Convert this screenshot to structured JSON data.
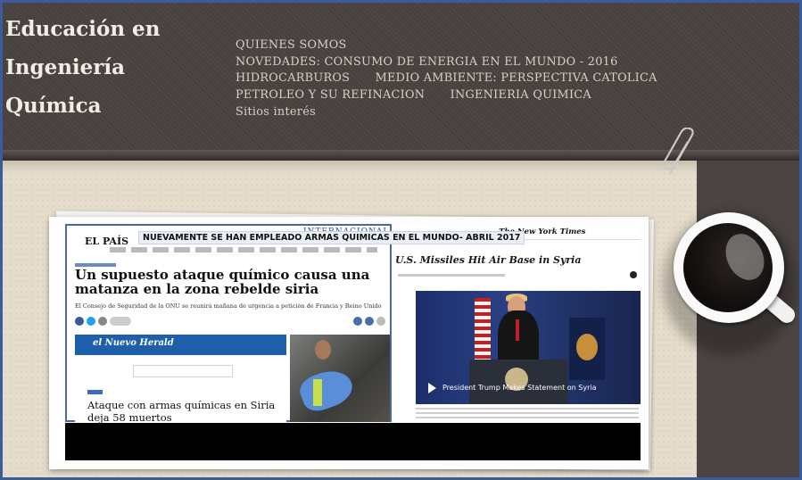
{
  "site": {
    "title_lines": [
      "Educación en",
      "Ingeniería",
      "Química"
    ]
  },
  "nav": {
    "rows": [
      [
        "QUIENES SOMOS"
      ],
      [
        "NOVEDADES: CONSUMO DE ENERGIA EN EL MUNDO - 2016"
      ],
      [
        "HIDROCARBUROS",
        "MEDIO AMBIENTE: PERSPECTIVA CATOLICA"
      ],
      [
        "PETROLEO Y SU REFINACION",
        "INGENIERIA QUIMICA"
      ],
      [
        "Sitios interés"
      ]
    ]
  },
  "featured": {
    "banner": "NUEVAMENTE SE HAN EMPLEADO ARMAS QUIMICAS EN EL MUNDO- ABRIL 2017",
    "elpais": {
      "logo": "EL PAÍS",
      "section": "INTERNACIONAL",
      "headline": "Un supuesto ataque químico causa una matanza en la zona rebelde siria",
      "subhead": "El Consejo de Seguridad de la ONU se reunirá mañana de urgencia a petición de Francia y Reino Unido"
    },
    "herald": {
      "logo": "el Nuevo Herald",
      "headline": "Ataque con armas químicas en Siria deja 58 muertos"
    },
    "nyt": {
      "logo": "The New York Times",
      "headline": "U.S. Missiles Hit Air Base in Syria",
      "video_caption": "President Trump Makes Statement on Syria"
    }
  },
  "colors": {
    "header_bg": "#4b4442",
    "frame_border": "#3a5c9a",
    "title_text": "#f2ede4",
    "nav_text": "#d8d1c2",
    "paper": "#e5dccb"
  }
}
